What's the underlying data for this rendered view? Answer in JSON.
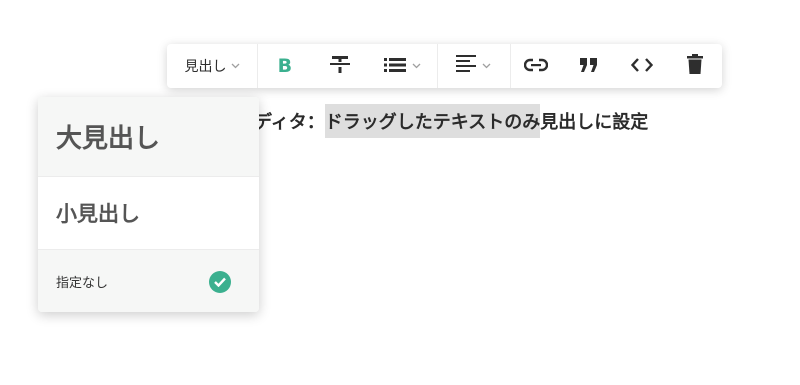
{
  "colors": {
    "accent": "#3bb08f",
    "highlight": "#dedede",
    "icon": "#2e2e2e"
  },
  "toolbar": {
    "heading_label": "見出し",
    "heading_chevron": "chevron-down-icon",
    "bold_label": "B",
    "strike_icon": "strikethrough-icon",
    "list_icon": "bullet-list-icon",
    "align_icon": "align-left-icon",
    "link_icon": "link-icon",
    "quote_icon": "quote-icon",
    "code_icon": "code-icon",
    "trash_icon": "trash-icon"
  },
  "editor": {
    "text_before": "ディタ：",
    "text_selected": "ドラッグしたテキストのみ",
    "text_after": "見出しに設定"
  },
  "dropdown": {
    "items": [
      {
        "label": "大見出し",
        "selected": false
      },
      {
        "label": "小見出し",
        "selected": false
      },
      {
        "label": "指定なし",
        "selected": true
      }
    ],
    "check_icon": "check-circle-icon"
  }
}
